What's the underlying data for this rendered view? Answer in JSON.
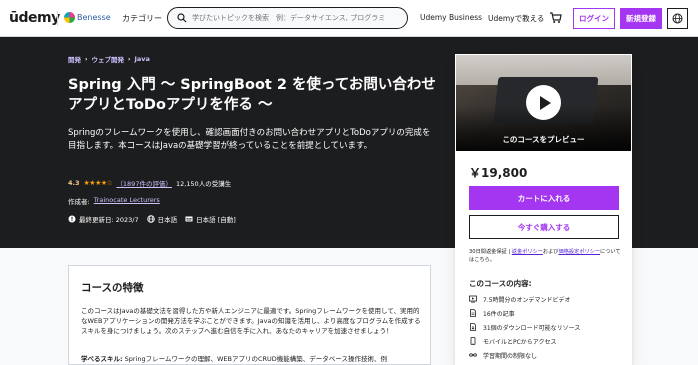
{
  "header": {
    "logo_text": "ūdemy",
    "partner_text": "Benesse",
    "categories_label": "カテゴリー",
    "search_placeholder": "学びたいトピックを検索　例：データサイエンス, プログラミ",
    "business_label": "Udemy Business",
    "teach_label": "Udemyで教える",
    "login_label": "ログイン",
    "signup_label": "新規登録"
  },
  "course": {
    "breadcrumb": [
      "開発",
      "ウェブ開発",
      "Java"
    ],
    "title": "Spring 入門 〜 SpringBoot 2 を使ってお問い合わせアプリとToDoアプリを作る 〜",
    "subtitle": "Springのフレームワークを使用し、確認画面付きのお問い合わせアプリとToDoアプリの完成を目指します。本コースはJavaの基礎学習が終っていることを前提としています。",
    "rating": "4.3",
    "stars": "★★★★☆",
    "ratings_count": "（1897件の評価）",
    "students": "12,150人の受講生",
    "author_label": "作成者:",
    "author": "Trainocate Lecturers",
    "updated": "最終更新日: 2023/7",
    "language": "日本語",
    "captions": "日本語 [自動]"
  },
  "card": {
    "preview_label": "このコースをプレビュー",
    "price": "￥19,800",
    "add_to_cart": "カートに入れる",
    "buy_now": "今すぐ購入する",
    "refund_prefix": "30日間返金保証 | ",
    "refund_link1": "返金ポリシー",
    "refund_mid": "および",
    "refund_link2": "価格設定ポリシー",
    "refund_suffix": "についてはこちら。",
    "includes_title": "このコースの内容:",
    "includes": [
      {
        "icon": "video-icon",
        "label": "7.5時間分のオンデマンドビデオ"
      },
      {
        "icon": "article-icon",
        "label": "16件の記事"
      },
      {
        "icon": "download-icon",
        "label": "31個のダウンロード可能なリソース"
      },
      {
        "icon": "mobile-icon",
        "label": "モバイルとPCからアクセス"
      },
      {
        "icon": "infinity-icon",
        "label": "学習期間の制限なし"
      }
    ]
  },
  "features": {
    "title": "コースの特徴",
    "description": "このコースはJavaの基礎文法を習得した方や新人エンジニアに最適です。Springフレームワークを使用して、実用的なWEBアプリケーションの開発方法を学ぶことができます。Javaの知識を活用し、より高度なプログラムを作成するスキルを身につけましょう。次のステップへ進む自信を手に入れ、あなたのキャリアを加速させましょう！",
    "skills_label": "学べるスキル:",
    "skills_text": " Springフレームワークの理解、WEBアプリのCRUD機能構築、データベース操作技術、例"
  },
  "colors": {
    "accent": "#a435f0",
    "hero_bg": "#1c1d1f",
    "link_light": "#cec0fc",
    "rating": "#f69c08"
  }
}
